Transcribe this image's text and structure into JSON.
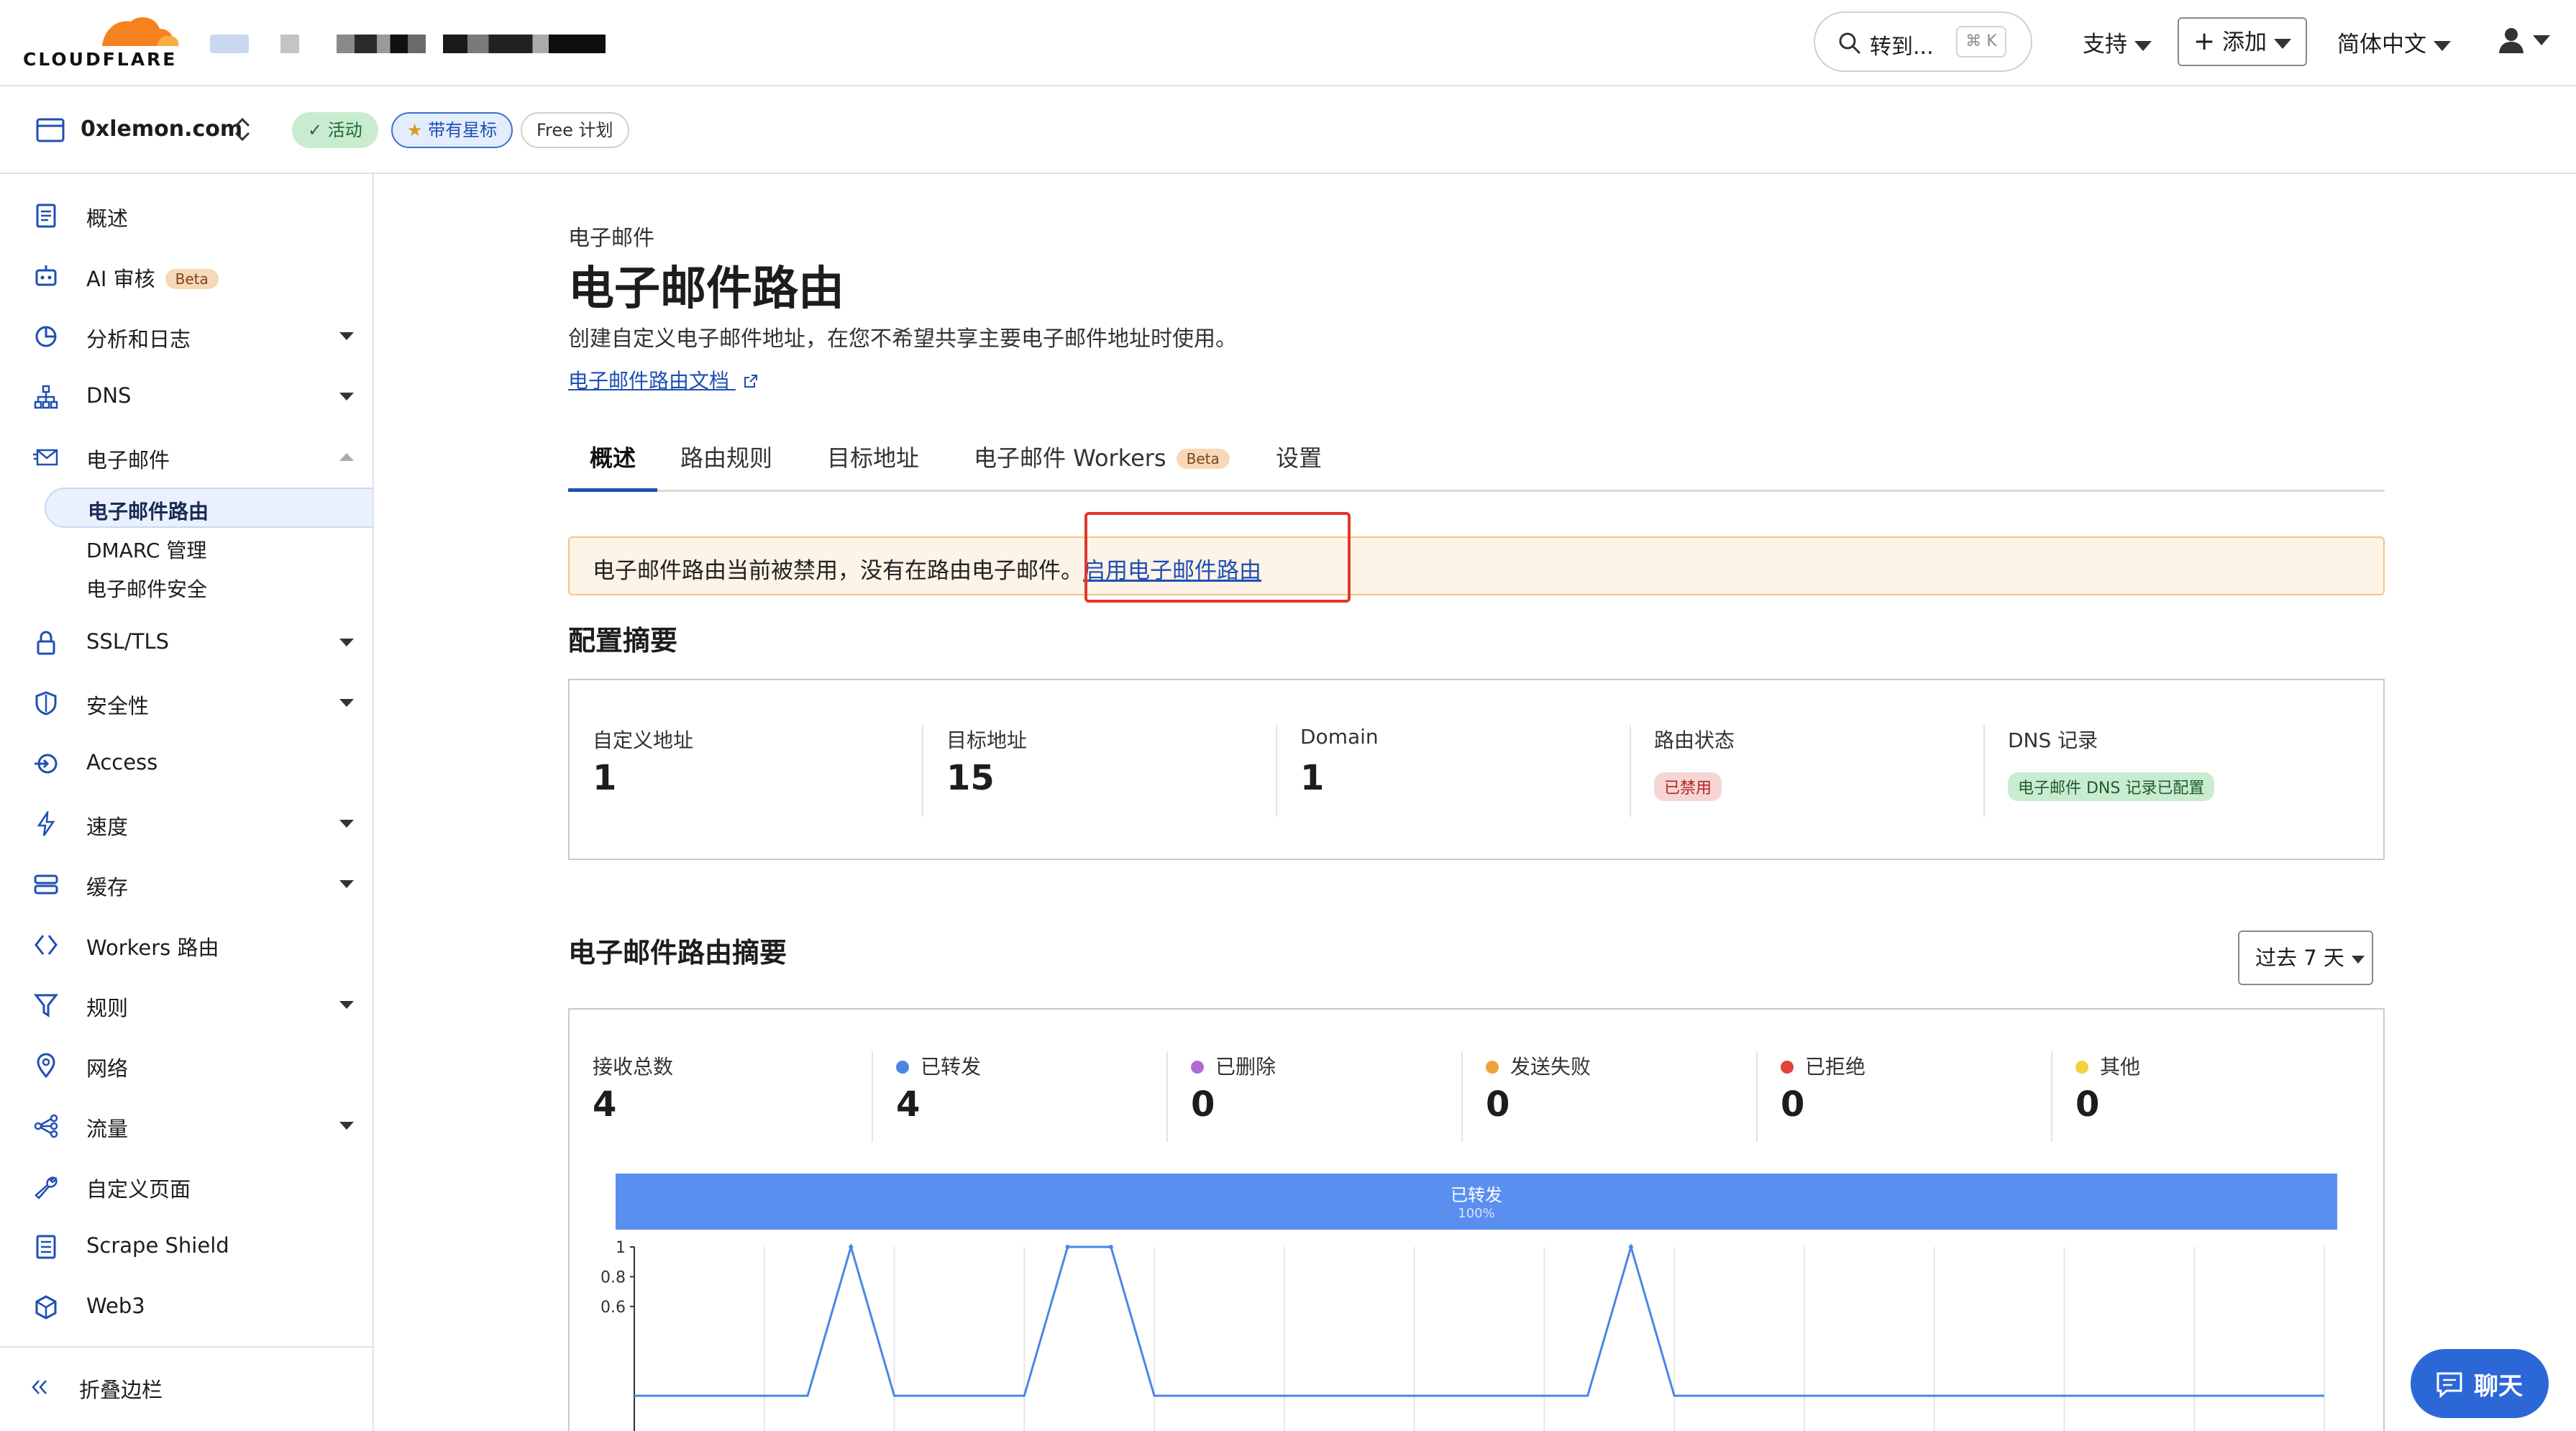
{
  "brand": {
    "logo_text": "CLOUDFLARE",
    "accent": "#f6821f"
  },
  "topbar": {
    "search_label": "转到...",
    "search_shortcut": "⌘ K",
    "support_label": "支持",
    "add_label": "添加",
    "language_label": "简体中文"
  },
  "zone": {
    "name": "0xlemon.com",
    "status_badge": "活动",
    "star_badge": "带有星标",
    "plan_badge": "Free 计划"
  },
  "sidebar": {
    "items": [
      {
        "label": "概述",
        "icon": "document-icon"
      },
      {
        "label": "AI 审核",
        "icon": "robot-icon",
        "badge": "Beta"
      },
      {
        "label": "分析和日志",
        "icon": "pie-chart-icon",
        "expandable": true
      },
      {
        "label": "DNS",
        "icon": "network-icon",
        "expandable": true
      },
      {
        "label": "电子邮件",
        "icon": "mail-icon",
        "expanded": true
      },
      {
        "label": "SSL/TLS",
        "icon": "lock-icon",
        "expandable": true
      },
      {
        "label": "安全性",
        "icon": "shield-icon",
        "expandable": true
      },
      {
        "label": "Access",
        "icon": "access-icon"
      },
      {
        "label": "速度",
        "icon": "bolt-icon",
        "expandable": true
      },
      {
        "label": "缓存",
        "icon": "storage-icon",
        "expandable": true
      },
      {
        "label": "Workers 路由",
        "icon": "workers-icon"
      },
      {
        "label": "规则",
        "icon": "funnel-icon",
        "expandable": true
      },
      {
        "label": "网络",
        "icon": "location-icon"
      },
      {
        "label": "流量",
        "icon": "traffic-icon",
        "expandable": true
      },
      {
        "label": "自定义页面",
        "icon": "wrench-icon"
      },
      {
        "label": "Scrape Shield",
        "icon": "scrape-shield-icon"
      },
      {
        "label": "Web3",
        "icon": "web3-icon"
      }
    ],
    "email_sub": [
      {
        "label": "电子邮件路由",
        "active": true
      },
      {
        "label": "DMARC 管理"
      },
      {
        "label": "电子邮件安全"
      }
    ],
    "collapse_label": "折叠边栏"
  },
  "page": {
    "breadcrumb": "电子邮件",
    "title": "电子邮件路由",
    "subtitle": "创建自定义电子邮件地址，在您不希望共享主要电子邮件地址时使用。",
    "doc_link": "电子邮件路由文档"
  },
  "tabs": [
    {
      "label": "概述",
      "active": true
    },
    {
      "label": "路由规则"
    },
    {
      "label": "目标地址"
    },
    {
      "label": "电子邮件 Workers",
      "badge": "Beta"
    },
    {
      "label": "设置"
    }
  ],
  "alert": {
    "text": "电子邮件路由当前被禁用，没有在路由电子邮件。",
    "link": "启用电子邮件路由"
  },
  "config_summary": {
    "title": "配置摘要",
    "columns": [
      {
        "label": "自定义地址",
        "value": "1"
      },
      {
        "label": "目标地址",
        "value": "15"
      },
      {
        "label": "Domain",
        "value": "1"
      },
      {
        "label": "路由状态",
        "tag": "已禁用",
        "tag_color": "#b3261e"
      },
      {
        "label": "DNS 记录",
        "tag": "电子邮件 DNS 记录已配置",
        "tag_color": "#1e5c2e"
      }
    ]
  },
  "routing_summary": {
    "title": "电子邮件路由摘要",
    "range_label": "过去 7 天",
    "stats": [
      {
        "label": "接收总数",
        "value": "4",
        "color": ""
      },
      {
        "label": "已转发",
        "value": "4",
        "color": "#4a86e8"
      },
      {
        "label": "已删除",
        "value": "0",
        "color": "#b36ad6"
      },
      {
        "label": "发送失败",
        "value": "0",
        "color": "#f0a23a"
      },
      {
        "label": "已拒绝",
        "value": "0",
        "color": "#e0443a"
      },
      {
        "label": "其他",
        "value": "0",
        "color": "#f2d13a"
      }
    ],
    "share_bar": {
      "label": "已转发",
      "percent": "100%"
    }
  },
  "chart_data": {
    "type": "line",
    "y_ticks": [
      "1",
      "0.8",
      "0.6"
    ],
    "ylim": [
      0,
      1
    ],
    "series": [
      {
        "values": [
          0,
          0,
          0,
          0,
          0,
          1,
          0,
          0,
          0,
          0,
          1,
          1,
          0,
          0,
          0,
          0,
          0,
          0,
          0,
          0,
          0,
          0,
          0,
          1,
          0,
          0,
          0,
          0,
          0,
          0,
          0,
          0,
          0,
          0,
          0,
          0,
          0,
          0,
          0,
          0
        ]
      }
    ],
    "grid": true,
    "line_color": "#4a86e8"
  },
  "chat": {
    "label": "聊天"
  }
}
